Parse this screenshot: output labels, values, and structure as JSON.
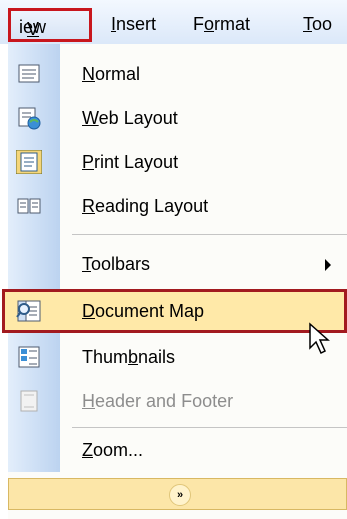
{
  "menubar": {
    "items": [
      {
        "label": "View"
      },
      {
        "label": "Insert"
      },
      {
        "label": "Format"
      },
      {
        "label": "Too"
      }
    ]
  },
  "menu": {
    "items": [
      {
        "label": "Normal",
        "icon": "normal-view-icon"
      },
      {
        "label": "Web Layout",
        "icon": "web-layout-icon"
      },
      {
        "label": "Print Layout",
        "icon": "print-layout-icon"
      },
      {
        "label": "Reading Layout",
        "icon": "reading-layout-icon"
      },
      {
        "label": "Toolbars",
        "icon": "",
        "submenu": true
      },
      {
        "label": "Document Map",
        "icon": "document-map-icon",
        "highlighted": true
      },
      {
        "label": "Thumbnails",
        "icon": "thumbnails-icon"
      },
      {
        "label": "Header and Footer",
        "icon": "header-footer-icon",
        "disabled": true
      },
      {
        "label": "Zoom...",
        "icon": ""
      }
    ],
    "expand_glyph": "»"
  },
  "colors": {
    "highlight_border": "#a21a1f",
    "highlight_fill": "#ffe9a8",
    "gutter": "#bcd3f0"
  }
}
